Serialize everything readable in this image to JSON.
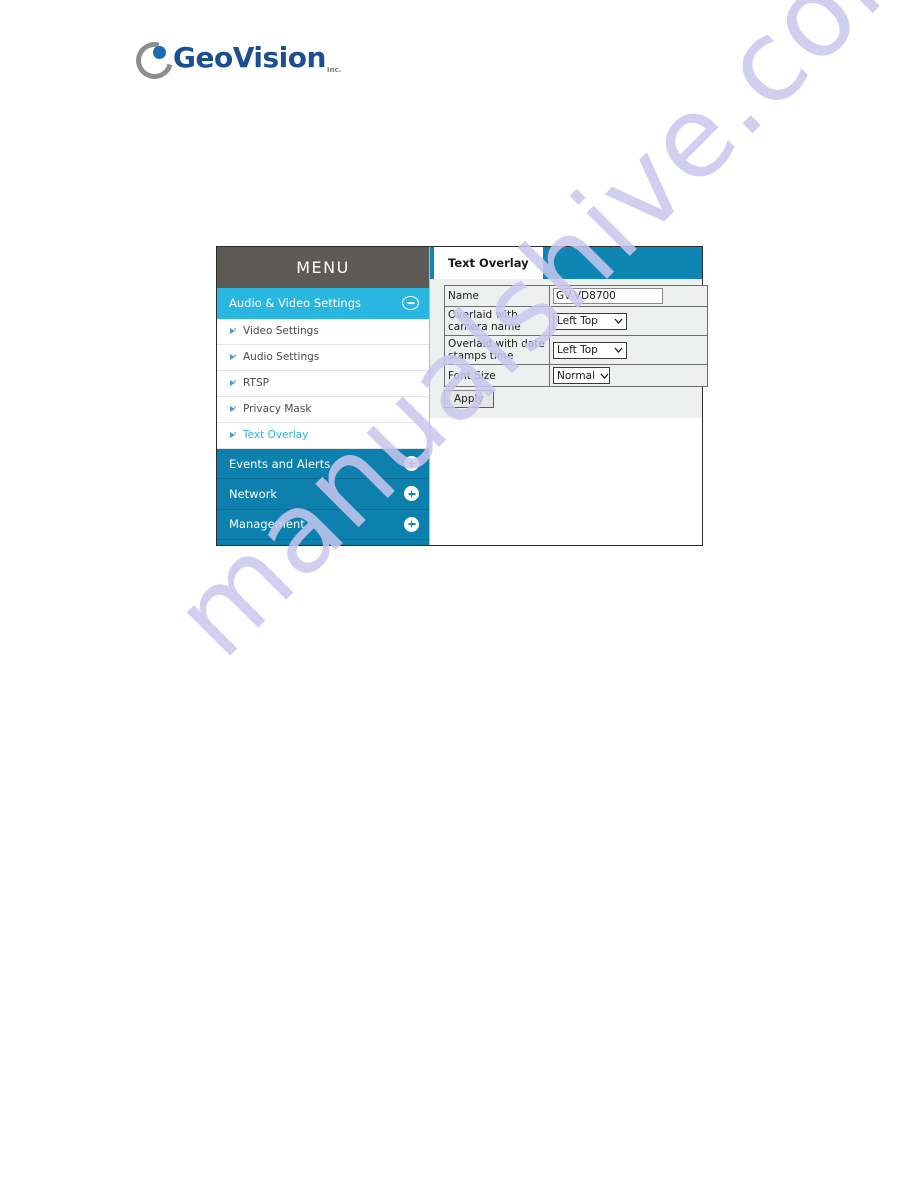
{
  "logo": {
    "word": "GeoVision",
    "suffix": "Inc.",
    "mark_icon": "geovision-swirl-icon",
    "brand_color": "#1b4f8f",
    "dot_color": "#1b6cb0"
  },
  "watermark": {
    "text": "manualshive.com",
    "color": "#c9c7ee"
  },
  "panel": {
    "menu": {
      "header": "MENU",
      "header_bg": "#5e5b57",
      "sections": [
        {
          "label": "Audio & Video Settings",
          "state": "expanded",
          "toggle_icon": "minus-circle-icon",
          "bg": "#29b6e0"
        },
        {
          "label": "Events and Alerts",
          "state": "collapsed",
          "toggle_icon": "plus-circle-icon",
          "bg": "#0d80ad"
        },
        {
          "label": "Network",
          "state": "collapsed",
          "toggle_icon": "plus-circle-icon",
          "bg": "#0d80ad"
        },
        {
          "label": "Management",
          "state": "collapsed",
          "toggle_icon": "plus-circle-icon",
          "bg": "#0d80ad"
        }
      ],
      "submenu": [
        {
          "label": "Video Settings",
          "active": false,
          "bullet_icon": "arrow-bullet-icon"
        },
        {
          "label": "Audio Settings",
          "active": false,
          "bullet_icon": "arrow-bullet-icon"
        },
        {
          "label": "RTSP",
          "active": false,
          "bullet_icon": "arrow-bullet-icon"
        },
        {
          "label": "Privacy Mask",
          "active": false,
          "bullet_icon": "arrow-bullet-icon"
        },
        {
          "label": "Text Overlay",
          "active": true,
          "bullet_icon": "arrow-bullet-icon"
        }
      ],
      "active_submenu_color": "#29b6e0"
    },
    "content": {
      "tab_bar_bg": "#0e85b3",
      "tabs": [
        {
          "label": "Text Overlay",
          "active": true
        }
      ],
      "form": {
        "rows": [
          {
            "label": "Name",
            "control": "text",
            "value": "GV-VD8700",
            "placeholder": ""
          },
          {
            "label": "Overlaid with camera name",
            "control": "select",
            "value": "Left Top",
            "size": "wide"
          },
          {
            "label": "Overlaid with date stamps time",
            "control": "select",
            "value": "Left Top",
            "size": "wide"
          },
          {
            "label": "Font Size",
            "control": "select",
            "value": "Normal",
            "size": "narrow"
          }
        ],
        "apply_label": "Apply"
      }
    }
  }
}
